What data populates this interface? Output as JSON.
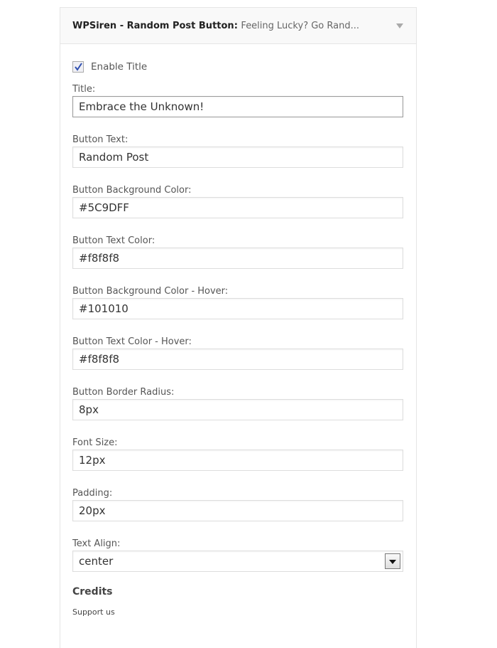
{
  "widget": {
    "title": "WPSiren - Random Post Button",
    "subtitle": "Feeling Lucky? Go Rand..."
  },
  "enable_title": {
    "label": "Enable Title",
    "checked": true
  },
  "fields": [
    {
      "label": "Title:",
      "value": "Embrace the Unknown!"
    },
    {
      "label": "Button Text:",
      "value": "Random Post"
    },
    {
      "label": "Button Background Color:",
      "value": "#5C9DFF"
    },
    {
      "label": "Button Text Color:",
      "value": "#f8f8f8"
    },
    {
      "label": "Button Background Color - Hover:",
      "value": "#101010"
    },
    {
      "label": "Button Text Color - Hover:",
      "value": "#f8f8f8"
    },
    {
      "label": "Button Border Radius:",
      "value": "8px"
    },
    {
      "label": "Font Size:",
      "value": "12px"
    },
    {
      "label": "Padding:",
      "value": "20px"
    }
  ],
  "text_align": {
    "label": "Text Align:",
    "value": "center"
  },
  "credits": {
    "heading": "Credits",
    "link": "Support us"
  }
}
